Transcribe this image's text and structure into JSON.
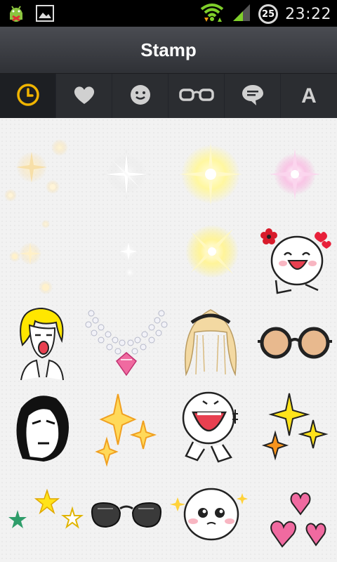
{
  "statusbar": {
    "time": "23:22",
    "battery_level": "25",
    "left_icons": [
      "android-debug-icon",
      "image-notification-icon"
    ],
    "right_icons": [
      "wifi-icon",
      "signal-icon",
      "battery-icon"
    ]
  },
  "header": {
    "title": "Stamp"
  },
  "tabs": [
    {
      "name": "recent",
      "icon": "clock-icon",
      "active": true
    },
    {
      "name": "favorites",
      "icon": "heart-icon",
      "active": false
    },
    {
      "name": "faces",
      "icon": "smiley-icon",
      "active": false
    },
    {
      "name": "accessories",
      "icon": "glasses-icon",
      "active": false
    },
    {
      "name": "speech",
      "icon": "speech-bubble-icon",
      "active": false
    },
    {
      "name": "text",
      "icon": "text-icon",
      "label": "A",
      "active": false
    }
  ],
  "stamps": [
    "sparkle-cluster-stamp",
    "white-sparkle-stamp",
    "yellow-sparkle-stamp",
    "pink-sparkle-stamp",
    "scattered-sparkles-stamp",
    "yellow-x-sparkle-stamp",
    "flower-girl-laughing-stamp",
    "blonde-face-stamp",
    "pearl-necklace-stamp",
    "blonde-wig-stamp",
    "round-glasses-stamp",
    "stern-face-stamp",
    "gold-sparkles-stamp",
    "laughing-pointing-stamp",
    "yellow-orange-sparkles-stamp",
    "stars-stamp",
    "sunglasses-stamp",
    "teary-face-stamp",
    "hearts-stamp"
  ],
  "colors": {
    "titlebar": "#3c3e43",
    "tabbar": "#2b2d31",
    "accent": "#f0b400",
    "background": "#f2f2f2"
  }
}
